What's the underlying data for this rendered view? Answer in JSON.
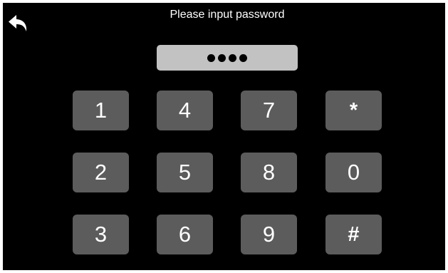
{
  "header": {
    "title": "Please input password",
    "back_icon": "back-arrow-icon"
  },
  "password": {
    "masked_length": 4
  },
  "keypad": {
    "columns": [
      [
        "1",
        "2",
        "3"
      ],
      [
        "4",
        "5",
        "6"
      ],
      [
        "7",
        "8",
        "9"
      ],
      [
        "*",
        "0",
        "#"
      ]
    ]
  },
  "colors": {
    "background": "#000000",
    "key": "#5c5c5c",
    "key_text": "#ffffff",
    "password_field": "#c2c2c2",
    "dot": "#000000"
  }
}
